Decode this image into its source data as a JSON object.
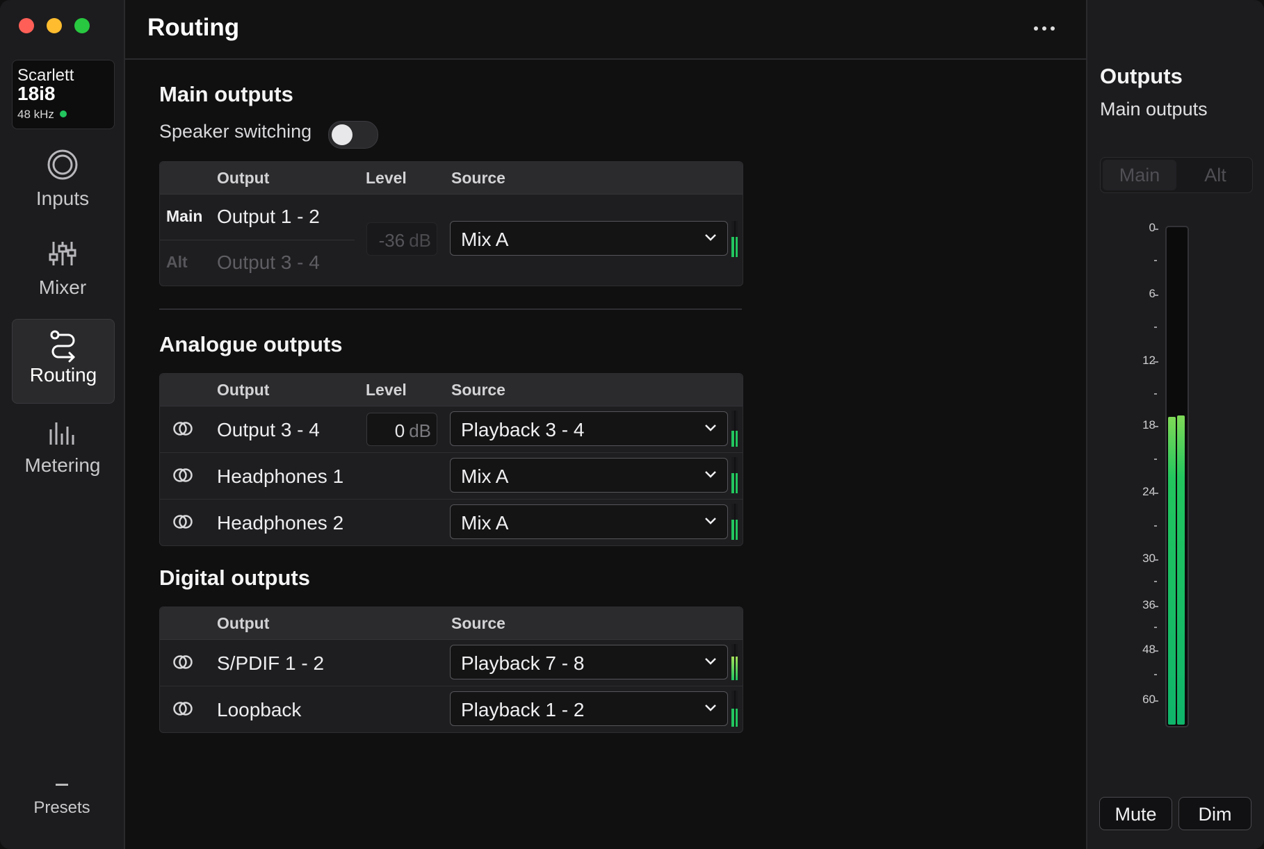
{
  "window": {
    "traffic_colors": [
      "#ff5f57",
      "#febc2e",
      "#28c840"
    ]
  },
  "device": {
    "brand": "Scarlett",
    "model": "18i8",
    "rate": "48 kHz",
    "status_color": "#22c55e"
  },
  "sidebar": {
    "items": [
      {
        "label": "Inputs",
        "icon": "inputs-icon"
      },
      {
        "label": "Mixer",
        "icon": "mixer-icon"
      },
      {
        "label": "Routing",
        "icon": "routing-icon",
        "active": true
      },
      {
        "label": "Metering",
        "icon": "metering-icon"
      }
    ],
    "presets_label": "Presets"
  },
  "header": {
    "title": "Routing",
    "more_icon": "more-icon"
  },
  "main_outputs": {
    "title": "Main outputs",
    "speaker_switching_label": "Speaker switching",
    "speaker_switching_on": false,
    "columns": {
      "output": "Output",
      "level": "Level",
      "source": "Source"
    },
    "rows": [
      {
        "tag": "Main",
        "output": "Output 1 - 2"
      },
      {
        "tag": "Alt",
        "output": "Output 3 - 4"
      }
    ],
    "level_value": "-36",
    "level_unit": "dB",
    "source": "Mix A",
    "meter_level": 0.55
  },
  "analogue_outputs": {
    "title": "Analogue outputs",
    "columns": {
      "output": "Output",
      "level": "Level",
      "source": "Source"
    },
    "rows": [
      {
        "output": "Output 3 - 4",
        "level_value": "0",
        "level_unit": "dB",
        "source": "Playback 3 - 4",
        "meter_level": 0.45
      },
      {
        "output": "Headphones 1",
        "source": "Mix A",
        "meter_level": 0.55
      },
      {
        "output": "Headphones 2",
        "source": "Mix A",
        "meter_level": 0.55
      }
    ]
  },
  "digital_outputs": {
    "title": "Digital outputs",
    "columns": {
      "output": "Output",
      "source": "Source"
    },
    "rows": [
      {
        "output": "S/PDIF 1 - 2",
        "source": "Playback 7 - 8",
        "meter_level": 0.65
      },
      {
        "output": "Loopback",
        "source": "Playback 1 - 2",
        "meter_level": 0.5
      }
    ]
  },
  "outputs_panel": {
    "title": "Outputs",
    "subtitle": "Main outputs",
    "tabs": [
      "Main",
      "Alt"
    ],
    "scale_labels": [
      "0",
      "6",
      "12",
      "18",
      "24",
      "30",
      "36",
      "48",
      "60"
    ],
    "meter_left": 0.62,
    "meter_right": 0.623,
    "mute_label": "Mute",
    "dim_label": "Dim"
  }
}
